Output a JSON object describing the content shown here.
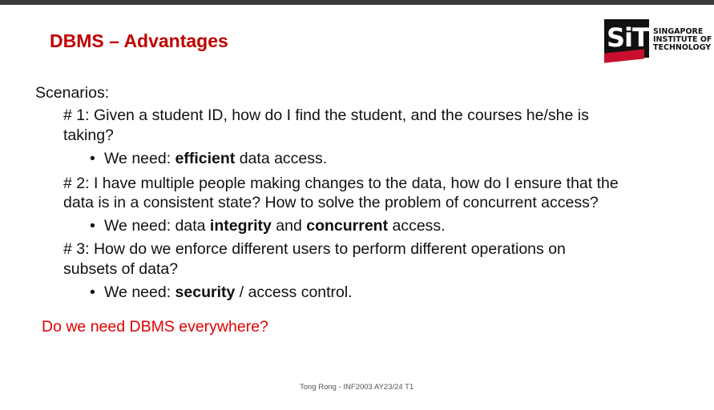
{
  "slide": {
    "title": "DBMS – Advantages",
    "logo": {
      "letters": "SiT",
      "line1": "SINGAPORE",
      "line2": "INSTITUTE OF",
      "line3": "TECHNOLOGY"
    },
    "scenarios_label": "Scenarios:",
    "items": [
      {
        "q_line1": "# 1: Given a student ID, how do I find the student, and the courses he/she is",
        "q_line2": "taking?",
        "need_prefix": "We need: ",
        "need_bold1": "efficient",
        "need_mid": " data access.",
        "need_bold2": "",
        "need_suffix": ""
      },
      {
        "q_line1": "# 2: I have multiple people making changes to the data, how do I ensure that the",
        "q_line2": "data is in a consistent state? How to solve the problem of concurrent access?",
        "need_prefix": "We need: data ",
        "need_bold1": "integrity",
        "need_mid": " and ",
        "need_bold2": "concurrent",
        "need_suffix": " access."
      },
      {
        "q_line1": "# 3: How do we enforce different users to perform different operations on",
        "q_line2": "subsets of data?",
        "need_prefix": "We need: ",
        "need_bold1": "security",
        "need_mid": " / access control.",
        "need_bold2": "",
        "need_suffix": ""
      }
    ],
    "question": "Do we need DBMS everywhere?",
    "footer": "Tong Rong - INF2003 AY23/24 T1",
    "colors": {
      "title": "#c00000",
      "question": "#e00000",
      "topbar": "#3a3a3a"
    }
  }
}
